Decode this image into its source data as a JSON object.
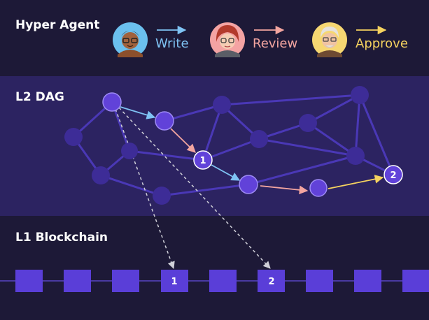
{
  "sections": {
    "agent_title": "Hyper Agent",
    "dag_title": "L2 DAG",
    "chain_title": "L1 Blockchain"
  },
  "agents": [
    {
      "label": "Write",
      "color": "#7fc3f4",
      "avatar_bg": "#6bc0ee",
      "icon": "developer-avatar-icon"
    },
    {
      "label": "Review",
      "color": "#f3a5a0",
      "avatar_bg": "#f4a3a3",
      "icon": "reviewer-avatar-icon"
    },
    {
      "label": "Approve",
      "color": "#f5d25f",
      "avatar_bg": "#f6d772",
      "icon": "approver-avatar-icon"
    }
  ],
  "dag": {
    "checkpoints": [
      "1",
      "2"
    ]
  },
  "chain": {
    "blocks": [
      "",
      "",
      "",
      "1",
      "",
      "2",
      "",
      "",
      ""
    ]
  },
  "colors": {
    "node": "#6142d9",
    "node_dim": "#3d2c97",
    "edge": "#4a38b6",
    "block": "#5a3ed8",
    "chain_line": "#5a46c6",
    "anchor_arrow": "#cfcfd8"
  }
}
